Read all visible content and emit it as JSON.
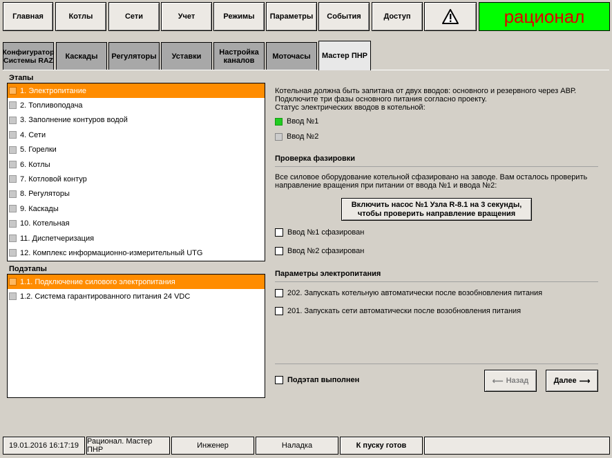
{
  "topnav": {
    "items": [
      "Главная",
      "Котлы",
      "Сети",
      "Учет",
      "Режимы",
      "Параметры",
      "События",
      "Доступ"
    ],
    "alert_icon": "warning-icon",
    "brand": "рационал",
    "brand_bg": "#00ff00",
    "brand_color": "#e00000"
  },
  "tabs": [
    {
      "label": "Конфигуратор Системы RAZ"
    },
    {
      "label": "Каскады"
    },
    {
      "label": "Регуляторы"
    },
    {
      "label": "Уставки"
    },
    {
      "label": "Настройка каналов"
    },
    {
      "label": "Моточасы"
    },
    {
      "label": "Мастер ПНР",
      "active": true
    }
  ],
  "stages": {
    "title": "Этапы",
    "items": [
      "1. Электропитание",
      "2. Топливоподача",
      "3. Заполнение контуров водой",
      "4. Сети",
      "5. Горелки",
      "6. Котлы",
      "7. Котловой контур",
      "8. Регуляторы",
      "9. Каскады",
      "10. Котельная",
      "11. Диспетчеризация",
      "12. Комплекс информационно-измерительный UTG"
    ],
    "selected_index": 0
  },
  "substages": {
    "title": "Подэтапы",
    "items": [
      "1.1. Подключение силового электропитания",
      "1.2. Система гарантированного питания 24 VDC"
    ],
    "selected_index": 0
  },
  "right": {
    "intro_1": "Котельная должна быть запитана от двух вводов: основного и резервного через АВР.",
    "intro_2": "Подключите три фазы основного питания согласно проекту.",
    "intro_3": "Статус электрических вводов в котельной:",
    "input1": {
      "label": "Ввод №1",
      "color": "#22cc22"
    },
    "input2": {
      "label": "Ввод №2",
      "color": "#cccccc"
    },
    "phase_title": "Проверка фазировки",
    "phase_text_1": "Все силовое оборудование котельной сфазировано на заводе. Вам осталось проверить",
    "phase_text_2": "направление вращения при питании от ввода №1 и ввода №2:",
    "pump_button_1": "Включить насос №1 Узла R-8.1 на 3 секунды,",
    "pump_button_2": "чтобы проверить направление вращения",
    "check1": "Ввод №1 сфазирован",
    "check2": "Ввод №2 сфазирован",
    "power_title": "Параметры электропитания",
    "param1": "202. Запускать котельную автоматически после возобновления питания",
    "param2": "201. Запускать сети автоматически после возобновления питания",
    "done_label": "Подэтап выполнен",
    "back_label": "Назад",
    "next_label": "Далее"
  },
  "statusbar": {
    "datetime": "19.01.2016 16:17:19",
    "mode": "Рационал. Мастер ПНР",
    "user": "Инженер",
    "state": "Наладка",
    "ready": "К пуску готов"
  }
}
